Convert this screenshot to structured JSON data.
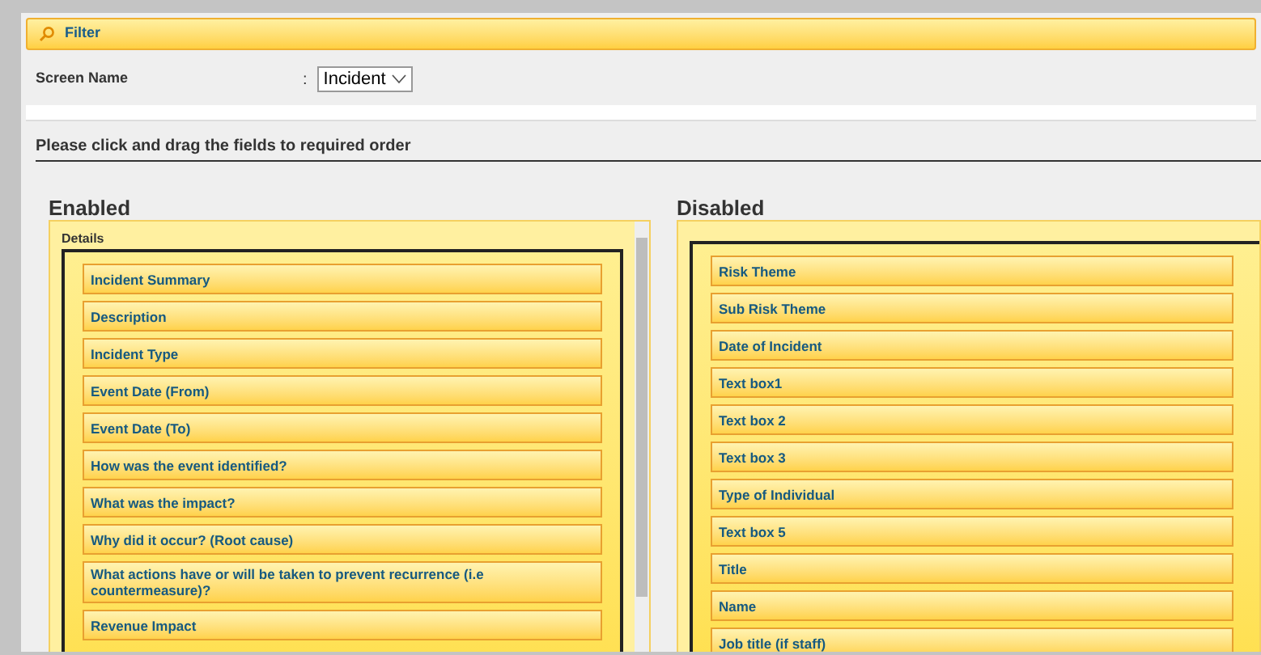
{
  "filter_bar": {
    "title": "Filter"
  },
  "screen_name": {
    "label": "Screen Name",
    "separator": ":",
    "value": "Incident"
  },
  "instruction": "Please click and drag the fields to required order",
  "enabled": {
    "heading": "Enabled",
    "section": "Details",
    "fields": [
      "Incident Summary",
      "Description",
      "Incident Type",
      "Event Date (From)",
      "Event Date (To)",
      "How was the event identified?",
      "What was the impact?",
      "Why did it occur? (Root cause)",
      "What actions have or will be taken to prevent recurrence (i.e countermeasure)?",
      "Revenue Impact"
    ]
  },
  "disabled": {
    "heading": "Disabled",
    "fields": [
      "Risk Theme",
      "Sub Risk Theme",
      "Date of Incident",
      "Text box1",
      "Text box 2",
      "Text box 3",
      "Type of Individual",
      "Text box 5",
      "Title",
      "Name",
      "Job title (if staff)"
    ]
  }
}
